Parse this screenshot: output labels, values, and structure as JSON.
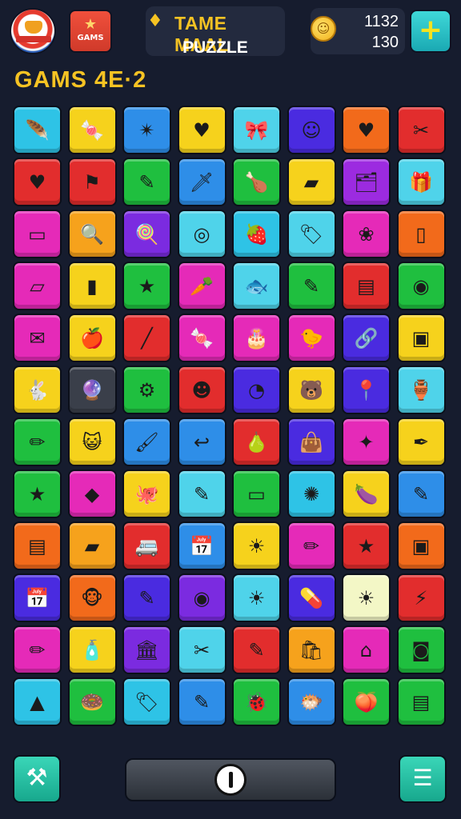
{
  "header": {
    "game_icon_label": "GAMS",
    "title_line1": "TAME MAAL",
    "title_line2": "PUZZLE",
    "score_top": "1132",
    "score_bottom": "130",
    "plus_label": "+"
  },
  "level_label": "GAMS 4E·2",
  "bottom": {
    "tool_icon": "hammer-icon",
    "center_icon": "power-icon",
    "menu_icon": "list-menu-icon"
  },
  "board": {
    "rows": 12,
    "cols": 8,
    "tiles": [
      [
        {
          "c": "#2ec3e6",
          "g": "🪶",
          "n": "feather-icon"
        },
        {
          "c": "#f6d21c",
          "g": "🍬",
          "n": "candy-icon"
        },
        {
          "c": "#2e8ee8",
          "g": "✴",
          "n": "burst-icon"
        },
        {
          "c": "#f6d21c",
          "g": "♥",
          "n": "heart-icon"
        },
        {
          "c": "#4fd3ea",
          "g": "🎀",
          "n": "bow-icon"
        },
        {
          "c": "#4a2be0",
          "g": "☺",
          "n": "face-icon"
        },
        {
          "c": "#f26a1b",
          "g": "♥",
          "n": "heart-icon"
        },
        {
          "c": "#e22d2d",
          "g": "✂",
          "n": "bird-icon"
        }
      ],
      [
        {
          "c": "#e22d2d",
          "g": "♥",
          "n": "heart-icon"
        },
        {
          "c": "#e22d2d",
          "g": "⚑",
          "n": "flag-icon"
        },
        {
          "c": "#1fbf3f",
          "g": "✎",
          "n": "marker-icon"
        },
        {
          "c": "#2e8ee8",
          "g": "🗡",
          "n": "knife-icon"
        },
        {
          "c": "#1fbf3f",
          "g": "🍗",
          "n": "drumstick-icon"
        },
        {
          "c": "#f6d21c",
          "g": "▰",
          "n": "tag-icon"
        },
        {
          "c": "#9c2be0",
          "g": "🗂",
          "n": "cards-icon"
        },
        {
          "c": "#4fd3ea",
          "g": "🎁",
          "n": "gift-icon"
        }
      ],
      [
        {
          "c": "#e52ab8",
          "g": "▭",
          "n": "card-icon"
        },
        {
          "c": "#f6a21c",
          "g": "🔍",
          "n": "magnifier-icon"
        },
        {
          "c": "#7b2be0",
          "g": "🍭",
          "n": "lollipop-icon"
        },
        {
          "c": "#4fd3ea",
          "g": "◎",
          "n": "coin-icon"
        },
        {
          "c": "#2ec3e6",
          "g": "🍓",
          "n": "strawberry-icon"
        },
        {
          "c": "#4fd3ea",
          "g": "🏷",
          "n": "ticket-icon"
        },
        {
          "c": "#e52ab8",
          "g": "❀",
          "n": "petals-icon"
        },
        {
          "c": "#f26a1b",
          "g": "▯",
          "n": "phone-icon"
        }
      ],
      [
        {
          "c": "#e52ab8",
          "g": "▱",
          "n": "box-icon"
        },
        {
          "c": "#f6d21c",
          "g": "▮",
          "n": "book-icon"
        },
        {
          "c": "#1fbf3f",
          "g": "★",
          "n": "star-icon"
        },
        {
          "c": "#e52ab8",
          "g": "🥕",
          "n": "carrot-icon"
        },
        {
          "c": "#4fd3ea",
          "g": "🐟",
          "n": "fish-icon"
        },
        {
          "c": "#1fbf3f",
          "g": "✎",
          "n": "brush-icon"
        },
        {
          "c": "#e22d2d",
          "g": "▤",
          "n": "sign-icon"
        },
        {
          "c": "#1fbf3f",
          "g": "◉",
          "n": "target-icon"
        }
      ],
      [
        {
          "c": "#e52ab8",
          "g": "✉",
          "n": "envelope-icon"
        },
        {
          "c": "#f6d21c",
          "g": "🍎",
          "n": "apple-icon"
        },
        {
          "c": "#e22d2d",
          "g": "╱",
          "n": "stick-icon"
        },
        {
          "c": "#e52ab8",
          "g": "🍬",
          "n": "candy-icon"
        },
        {
          "c": "#e52ab8",
          "g": "🎂",
          "n": "cake-icon"
        },
        {
          "c": "#e52ab8",
          "g": "🐤",
          "n": "chick-icon"
        },
        {
          "c": "#4a2be0",
          "g": "🔗",
          "n": "tag-icon"
        },
        {
          "c": "#f6d21c",
          "g": "▣",
          "n": "frame-icon"
        }
      ],
      [
        {
          "c": "#f6d21c",
          "g": "🐇",
          "n": "rabbit-icon"
        },
        {
          "c": "#3a3f4a",
          "g": "🔮",
          "n": "orb-icon"
        },
        {
          "c": "#1fbf3f",
          "g": "⚙",
          "n": "gear-icon"
        },
        {
          "c": "#e22d2d",
          "g": "☻",
          "n": "smiley-icon"
        },
        {
          "c": "#4a2be0",
          "g": "◔",
          "n": "spiral-icon"
        },
        {
          "c": "#f6d21c",
          "g": "🐻",
          "n": "bear-icon"
        },
        {
          "c": "#4a2be0",
          "g": "📍",
          "n": "pin-icon"
        },
        {
          "c": "#4fd3ea",
          "g": "🏺",
          "n": "jar-icon"
        }
      ],
      [
        {
          "c": "#1fbf3f",
          "g": "✏",
          "n": "pencil-icon"
        },
        {
          "c": "#f6d21c",
          "g": "😺",
          "n": "cat-icon"
        },
        {
          "c": "#2e8ee8",
          "g": "🖌",
          "n": "brush-icon"
        },
        {
          "c": "#2e8ee8",
          "g": "↩",
          "n": "hook-icon"
        },
        {
          "c": "#e22d2d",
          "g": "🍐",
          "n": "pear-icon"
        },
        {
          "c": "#4a2be0",
          "g": "👜",
          "n": "bag-icon"
        },
        {
          "c": "#e52ab8",
          "g": "✦",
          "n": "sparkle-icon"
        },
        {
          "c": "#f6d21c",
          "g": "✒",
          "n": "pen-icon"
        }
      ],
      [
        {
          "c": "#1fbf3f",
          "g": "★",
          "n": "star-icon"
        },
        {
          "c": "#e52ab8",
          "g": "◆",
          "n": "diamond-icon"
        },
        {
          "c": "#f6d21c",
          "g": "🐙",
          "n": "octopus-icon"
        },
        {
          "c": "#4fd3ea",
          "g": "✎",
          "n": "pencil-icon"
        },
        {
          "c": "#1fbf3f",
          "g": "▭",
          "n": "card-icon"
        },
        {
          "c": "#2ec3e6",
          "g": "✺",
          "n": "sun-icon"
        },
        {
          "c": "#f6d21c",
          "g": "🍆",
          "n": "eggplant-icon"
        },
        {
          "c": "#2e8ee8",
          "g": "✎",
          "n": "marker-icon"
        }
      ],
      [
        {
          "c": "#f26a1b",
          "g": "▤",
          "n": "jar-icon"
        },
        {
          "c": "#f6a21c",
          "g": "▰",
          "n": "folder-icon"
        },
        {
          "c": "#e22d2d",
          "g": "🚐",
          "n": "van-icon"
        },
        {
          "c": "#2e8ee8",
          "g": "📅",
          "n": "calendar-icon"
        },
        {
          "c": "#f6d21c",
          "g": "☀",
          "n": "sun-icon"
        },
        {
          "c": "#e52ab8",
          "g": "✏",
          "n": "pencil-icon"
        },
        {
          "c": "#e22d2d",
          "g": "★",
          "n": "star-icon"
        },
        {
          "c": "#f26a1b",
          "g": "▣",
          "n": "device-icon"
        }
      ],
      [
        {
          "c": "#4a2be0",
          "g": "📅",
          "n": "calendar-icon"
        },
        {
          "c": "#f26a1b",
          "g": "🐵",
          "n": "monkey-icon"
        },
        {
          "c": "#4a2be0",
          "g": "✎",
          "n": "brush-icon"
        },
        {
          "c": "#7b2be0",
          "g": "◉",
          "n": "ring-icon"
        },
        {
          "c": "#4fd3ea",
          "g": "☀",
          "n": "sun-icon"
        },
        {
          "c": "#4a2be0",
          "g": "💊",
          "n": "capsule-icon"
        },
        {
          "c": "#f3f7c6",
          "g": "☀",
          "n": "sun-icon"
        },
        {
          "c": "#e22d2d",
          "g": "⚡",
          "n": "bolt-icon"
        }
      ],
      [
        {
          "c": "#e52ab8",
          "g": "✏",
          "n": "pencil-icon"
        },
        {
          "c": "#f6d21c",
          "g": "🧴",
          "n": "bottle-icon"
        },
        {
          "c": "#7b2be0",
          "g": "🏛",
          "n": "building-icon"
        },
        {
          "c": "#4fd3ea",
          "g": "✂",
          "n": "scissors-icon"
        },
        {
          "c": "#e22d2d",
          "g": "✎",
          "n": "pencil-icon"
        },
        {
          "c": "#f6a21c",
          "g": "🛍",
          "n": "shopping-bag-icon"
        },
        {
          "c": "#e52ab8",
          "g": "⌂",
          "n": "house-icon"
        },
        {
          "c": "#1fbf3f",
          "g": "◙",
          "n": "frame-icon"
        }
      ],
      [
        {
          "c": "#2ec3e6",
          "g": "▲",
          "n": "cone-icon"
        },
        {
          "c": "#1fbf3f",
          "g": "🍩",
          "n": "donut-icon"
        },
        {
          "c": "#2ec3e6",
          "g": "🏷",
          "n": "tag-icon"
        },
        {
          "c": "#2e8ee8",
          "g": "✎",
          "n": "pencil-icon"
        },
        {
          "c": "#1fbf3f",
          "g": "🐞",
          "n": "bug-icon"
        },
        {
          "c": "#2e8ee8",
          "g": "🐡",
          "n": "fish-icon"
        },
        {
          "c": "#1fbf3f",
          "g": "🍑",
          "n": "peach-icon"
        },
        {
          "c": "#1fbf3f",
          "g": "▤",
          "n": "radio-icon"
        }
      ]
    ]
  }
}
